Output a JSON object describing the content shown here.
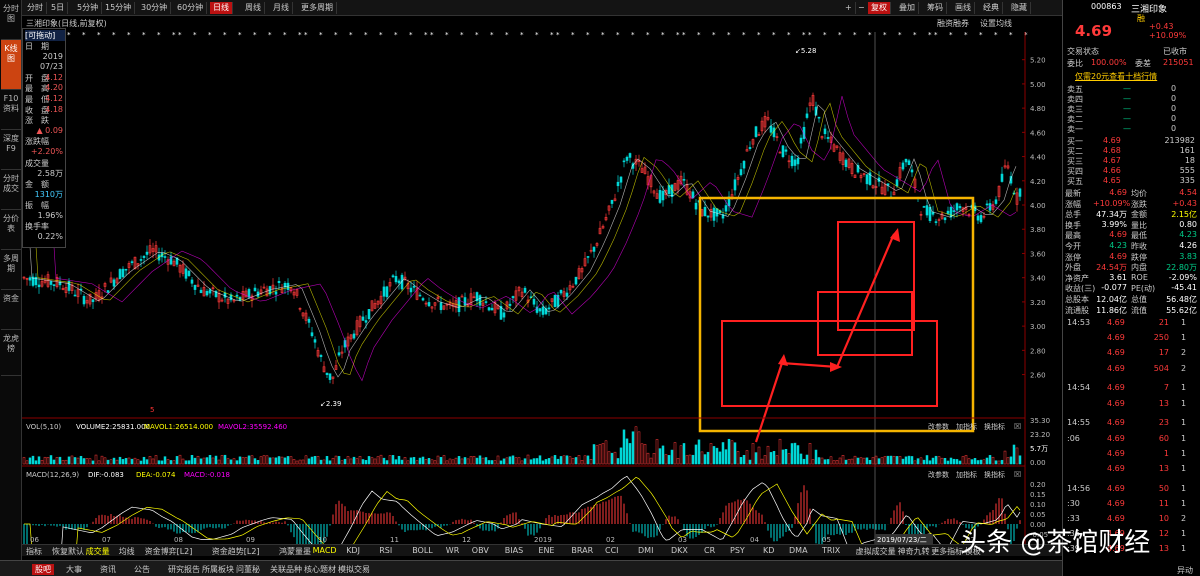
{
  "topbar": {
    "periods": [
      "分时",
      "5日",
      "5分钟",
      "15分钟",
      "30分钟",
      "60分钟",
      "日线",
      "周线",
      "月线",
      "更多周期"
    ],
    "active_period": "日线",
    "right_tools": [
      "+",
      "−",
      "复权",
      "叠加",
      "筹码",
      "画线",
      "经典",
      "隐藏"
    ],
    "sub_right": [
      "融资融券",
      "设置均线"
    ],
    "stock_label": "三湘印象",
    "stock_suffix": "(日线,前复权)"
  },
  "left_tabs": [
    "分时图",
    "K线图",
    "F10资料",
    "深度F9",
    "分时成交",
    "分价表",
    "多周期",
    "资金",
    "龙虎榜"
  ],
  "infobox": {
    "title": "[可拖动]",
    "rows": [
      {
        "label": "日　期",
        "value": ""
      },
      {
        "label": "",
        "value": "2019"
      },
      {
        "label": "",
        "value": "07/23"
      },
      {
        "label": "开　盘",
        "value": "4.12"
      },
      {
        "label": "最　高",
        "value": "4.20"
      },
      {
        "label": "最　低",
        "value": "4.12"
      },
      {
        "label": "收　盘",
        "value": "4.18"
      },
      {
        "label": "涨　跌",
        "value": ""
      },
      {
        "label": "",
        "value": "▲ 0.09"
      },
      {
        "label": "涨跌幅",
        "value": ""
      },
      {
        "label": "",
        "value": "+2.20%"
      },
      {
        "label": "成交量",
        "value": ""
      },
      {
        "label": "",
        "value": "2.58万"
      },
      {
        "label": "金　额",
        "value": ""
      },
      {
        "label": "",
        "value": "1310万"
      },
      {
        "label": "振　幅",
        "value": ""
      },
      {
        "label": "",
        "value": "1.96%"
      },
      {
        "label": "换手率",
        "value": ""
      },
      {
        "label": "",
        "value": "0.22%"
      }
    ]
  },
  "price_axis": [
    "5.20",
    "5.00",
    "4.80",
    "4.60",
    "4.40",
    "4.20",
    "4.00",
    "3.80",
    "3.60",
    "3.40",
    "3.20",
    "3.00",
    "2.80",
    "2.60"
  ],
  "annotations": {
    "high": "5.28",
    "low": "2.39",
    "marker": "5"
  },
  "vol_panel": {
    "label": "VOL(5,10)",
    "vol": "VOLUME2:25831.000",
    "mavol1": "MAVOL1:26514.000",
    "mavol2": "MAVOL2:35592.460",
    "axis": [
      "35.30",
      "23.20",
      "5.7万",
      "0.00"
    ],
    "tools": [
      "改参数",
      "加指标",
      "换指标"
    ]
  },
  "macd_panel": {
    "label": "MACD(12,26,9)",
    "dif": "DIF:-0.083",
    "dea": "DEA:-0.074",
    "macd": "MACD:-0.018",
    "axis": [
      "0.20",
      "0.15",
      "0.10",
      "0.05",
      "0.00",
      "-0.05"
    ],
    "tools": [
      "改参数",
      "加指标",
      "换指标"
    ]
  },
  "time_axis": [
    "06",
    "07",
    "08",
    "09",
    "10",
    "11",
    "12",
    "2019",
    "02",
    "03",
    "04",
    "05",
    "06",
    "07"
  ],
  "crosshair_date": "2019/07/23/二",
  "bottom_tabs": [
    "指标",
    "恢复默认",
    "成交量",
    "均线",
    "资金博弈[L2]",
    "资金趋势[L2]",
    "鸿蒙量墨",
    "MACD",
    "KDJ",
    "RSI",
    "BOLL",
    "WR",
    "OBV",
    "BIAS",
    "ENE",
    "BRAR",
    "CCI",
    "DMI",
    "DKX",
    "CR",
    "PSY",
    "KD",
    "DMA",
    "TRIX",
    "虚拟成交量",
    "神奇九转",
    "更多指标",
    "模板"
  ],
  "status_tabs": [
    "股吧",
    "大事",
    "资讯",
    "公告",
    "研究报告",
    "所属板块",
    "问董秘",
    "关联品种",
    "核心题材",
    "模拟交易"
  ],
  "watermark": "头条 @茶馆财经",
  "right": {
    "code": "000863",
    "name": "三湘印象",
    "badge": "融",
    "price": "4.69",
    "change": "+0.43",
    "pct": "+10.09%",
    "status_lbl": "交易状态",
    "status": "已收市",
    "webi_lbl": "委比",
    "webi": "100.00%",
    "weicha_lbl": "委差",
    "weicha": "215051",
    "promo": "仅需20元查看十档行情",
    "asks": [
      {
        "l": "卖五",
        "p": "—",
        "v": "0"
      },
      {
        "l": "卖四",
        "p": "—",
        "v": "0"
      },
      {
        "l": "卖三",
        "p": "—",
        "v": "0"
      },
      {
        "l": "卖二",
        "p": "—",
        "v": "0"
      },
      {
        "l": "卖一",
        "p": "—",
        "v": "0"
      }
    ],
    "bids": [
      {
        "l": "买一",
        "p": "4.69",
        "v": "213982"
      },
      {
        "l": "买二",
        "p": "4.68",
        "v": "161"
      },
      {
        "l": "买三",
        "p": "4.67",
        "v": "18"
      },
      {
        "l": "买四",
        "p": "4.66",
        "v": "555"
      },
      {
        "l": "买五",
        "p": "4.65",
        "v": "335"
      }
    ],
    "stats": [
      [
        "最新",
        "4.69",
        "均价",
        "4.54"
      ],
      [
        "涨幅",
        "+10.09%",
        "涨跌",
        "+0.43"
      ],
      [
        "总手",
        "47.34万",
        "金额",
        "2.15亿"
      ],
      [
        "换手",
        "3.99%",
        "量比",
        "0.80"
      ],
      [
        "最高",
        "4.69",
        "最低",
        "4.23"
      ],
      [
        "今开",
        "4.23",
        "昨收",
        "4.26"
      ],
      [
        "涨停",
        "4.69",
        "跌停",
        "3.83"
      ],
      [
        "外盘",
        "24.54万",
        "内盘",
        "22.80万"
      ],
      [
        "净资产",
        "3.61",
        "ROE",
        "-2.09%"
      ],
      [
        "收益(三)",
        "-0.077",
        "PE(动)",
        "-45.41"
      ],
      [
        "总股本",
        "12.04亿",
        "总值",
        "56.48亿"
      ],
      [
        "流通股",
        "11.86亿",
        "流值",
        "55.62亿"
      ]
    ],
    "ticks": [
      {
        "t": "14:53",
        "p": "4.69",
        "v": "21",
        "n": "1"
      },
      {
        "t": "",
        "p": "4.69",
        "v": "250",
        "n": "1"
      },
      {
        "t": "",
        "p": "4.69",
        "v": "17",
        "n": "2"
      },
      {
        "t": "",
        "p": "4.69",
        "v": "504",
        "n": "2"
      },
      {
        "t": "14:54",
        "p": "4.69",
        "v": "7",
        "n": "1"
      },
      {
        "t": "",
        "p": "4.69",
        "v": "13",
        "n": "1"
      },
      {
        "t": "14:55",
        "p": "4.69",
        "v": "23",
        "n": "1"
      },
      {
        "t": ":06",
        "p": "4.69",
        "v": "60",
        "n": "1"
      },
      {
        "t": "",
        "p": "4.69",
        "v": "1",
        "n": "1"
      },
      {
        "t": "",
        "p": "4.69",
        "v": "13",
        "n": "1"
      },
      {
        "t": "14:56",
        "p": "4.69",
        "v": "50",
        "n": "1"
      },
      {
        "t": ":30",
        "p": "4.69",
        "v": "11",
        "n": "1"
      },
      {
        "t": ":33",
        "p": "4.69",
        "v": "10",
        "n": "2"
      },
      {
        "t": ":36",
        "p": "4.69",
        "v": "12",
        "n": "1"
      },
      {
        "t": ":39",
        "p": "4.69",
        "v": "13",
        "n": "1"
      }
    ],
    "footer": "异动"
  },
  "colors": {
    "up": "#ff3a3a",
    "down": "#00d8d8",
    "box": "#f5b400",
    "redbox": "#ff2020",
    "ma5": "#ffffff",
    "ma10": "#ffff00",
    "ma20": "#ff00ff"
  }
}
